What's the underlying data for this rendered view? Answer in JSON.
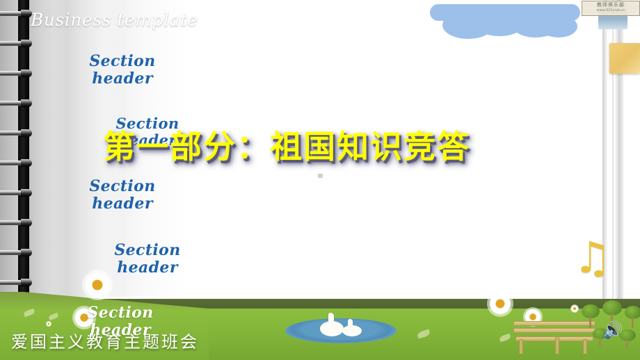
{
  "slide": {
    "template_label": "Business template",
    "main_title": "第一部分：祖国知识竞答",
    "footer_title": "爱国主义教育主题班会",
    "watermark": {
      "name": "教师俱乐部",
      "url": "www.915club.cn"
    }
  },
  "section_headers": [
    {
      "id": "sh1",
      "text": "Section\nheader",
      "color": "#1f63ab"
    },
    {
      "id": "sh2",
      "text": "Section\nheader",
      "color": "#1f63ab"
    },
    {
      "id": "sh3",
      "text": "Section\nheader",
      "color": "#1f63ab"
    },
    {
      "id": "sh4",
      "text": "Section\nheader",
      "color": "#1f63ab"
    },
    {
      "id": "sh5",
      "text": "Section\nheader",
      "color": "#ffffff"
    }
  ],
  "colors": {
    "title_fill": "#ffff00",
    "title_shadow": "#56567a",
    "section_blue": "#1f63ab",
    "grass": "#8cbd3f",
    "dark_band": "#556a32",
    "cloud": "#9cc0ea",
    "sticky_note": "#efcb72",
    "music_note": "#e9c33f",
    "pond": "#5f9cc4"
  },
  "icons": {
    "music_note": "♫",
    "speaker": "🔊",
    "cloud": "cloud-shape",
    "pencil": "pencil-shape",
    "sticky": "sticky-note",
    "swan": "swan-shape",
    "bench": "park-bench",
    "tree": "tree-shape",
    "daisy": "daisy-flower",
    "spiral": "spiral-binding"
  },
  "decor": {
    "ring_count": 10,
    "daisy_count": 6,
    "tree_count": 5
  }
}
